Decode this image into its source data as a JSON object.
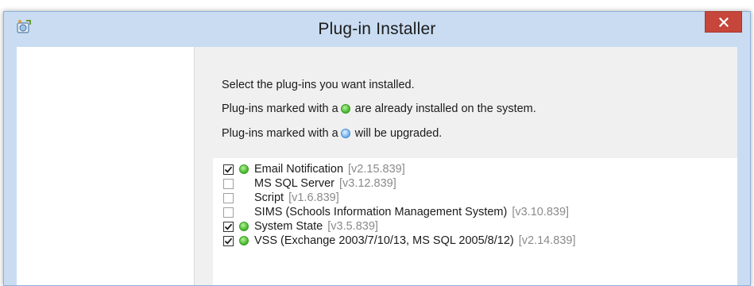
{
  "window": {
    "title": "Plug-in Installer",
    "close_icon": "close-icon",
    "app_icon": "installer-app-icon"
  },
  "instructions": {
    "line1": "Select the plug-ins you want installed.",
    "line2_before": "Plug-ins marked with a",
    "line2_after": "are already installed on the system.",
    "line3_before": "Plug-ins marked with a",
    "line3_after": "will be upgraded."
  },
  "colors": {
    "installed_dot": "#4fbe33",
    "upgrade_dot": "#79b8ef",
    "close_button": "#c6463b"
  },
  "plugins": [
    {
      "name": "Email Notification",
      "version": "[v2.15.839]",
      "checked": true,
      "status": "installed"
    },
    {
      "name": "MS SQL Server",
      "version": "[v3.12.839]",
      "checked": false,
      "status": "none"
    },
    {
      "name": "Script",
      "version": "[v1.6.839]",
      "checked": false,
      "status": "none"
    },
    {
      "name": "SIMS (Schools Information Management System)",
      "version": "[v3.10.839]",
      "checked": false,
      "status": "none"
    },
    {
      "name": "System State",
      "version": "[v3.5.839]",
      "checked": true,
      "status": "installed"
    },
    {
      "name": "VSS (Exchange 2003/7/10/13, MS SQL 2005/8/12)",
      "version": "[v2.14.839]",
      "checked": true,
      "status": "installed"
    }
  ]
}
